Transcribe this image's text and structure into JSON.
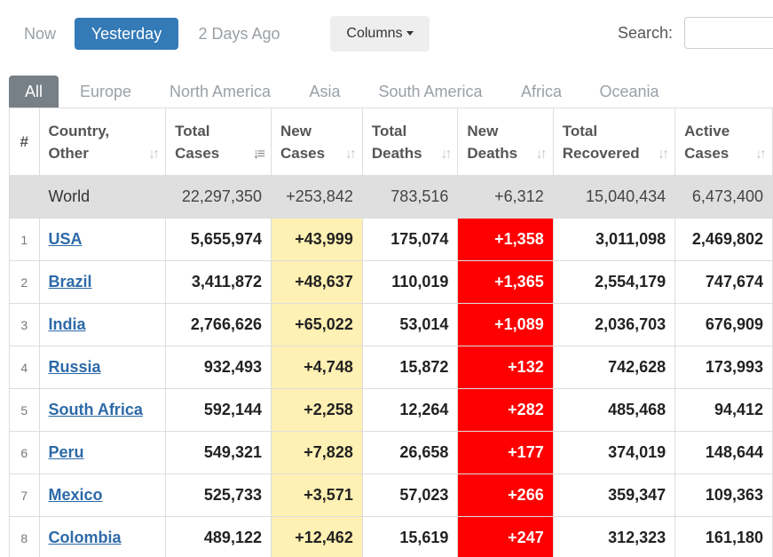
{
  "day_filter": {
    "now": "Now",
    "yesterday": "Yesterday",
    "two_days_ago": "2 Days Ago",
    "selected": "Yesterday"
  },
  "columns_button": "Columns",
  "search": {
    "label": "Search:",
    "value": ""
  },
  "region_tabs": [
    "All",
    "Europe",
    "North America",
    "Asia",
    "South America",
    "Africa",
    "Oceania"
  ],
  "active_tab": "All",
  "headers": {
    "rank": "#",
    "country_line1": "Country,",
    "country_line2": "Other",
    "total_cases_1": "Total",
    "total_cases_2": "Cases",
    "new_cases_1": "New",
    "new_cases_2": "Cases",
    "total_deaths_1": "Total",
    "total_deaths_2": "Deaths",
    "new_deaths_1": "New",
    "new_deaths_2": "Deaths",
    "total_recovered_1": "Total",
    "total_recovered_2": "Recovered",
    "active_cases_1": "Active",
    "active_cases_2": "Cases"
  },
  "world": {
    "country": "World",
    "total_cases": "22,297,350",
    "new_cases": "+253,842",
    "total_deaths": "783,516",
    "new_deaths": "+6,312",
    "total_recovered": "15,040,434",
    "active_cases": "6,473,400"
  },
  "rows": [
    {
      "rank": "1",
      "country": "USA",
      "total_cases": "5,655,974",
      "new_cases": "+43,999",
      "total_deaths": "175,074",
      "new_deaths": "+1,358",
      "total_recovered": "3,011,098",
      "active_cases": "2,469,802"
    },
    {
      "rank": "2",
      "country": "Brazil",
      "total_cases": "3,411,872",
      "new_cases": "+48,637",
      "total_deaths": "110,019",
      "new_deaths": "+1,365",
      "total_recovered": "2,554,179",
      "active_cases": "747,674"
    },
    {
      "rank": "3",
      "country": "India",
      "total_cases": "2,766,626",
      "new_cases": "+65,022",
      "total_deaths": "53,014",
      "new_deaths": "+1,089",
      "total_recovered": "2,036,703",
      "active_cases": "676,909"
    },
    {
      "rank": "4",
      "country": "Russia",
      "total_cases": "932,493",
      "new_cases": "+4,748",
      "total_deaths": "15,872",
      "new_deaths": "+132",
      "total_recovered": "742,628",
      "active_cases": "173,993"
    },
    {
      "rank": "5",
      "country": "South Africa",
      "total_cases": "592,144",
      "new_cases": "+2,258",
      "total_deaths": "12,264",
      "new_deaths": "+282",
      "total_recovered": "485,468",
      "active_cases": "94,412"
    },
    {
      "rank": "6",
      "country": "Peru",
      "total_cases": "549,321",
      "new_cases": "+7,828",
      "total_deaths": "26,658",
      "new_deaths": "+177",
      "total_recovered": "374,019",
      "active_cases": "148,644"
    },
    {
      "rank": "7",
      "country": "Mexico",
      "total_cases": "525,733",
      "new_cases": "+3,571",
      "total_deaths": "57,023",
      "new_deaths": "+266",
      "total_recovered": "359,347",
      "active_cases": "109,363"
    },
    {
      "rank": "8",
      "country": "Colombia",
      "total_cases": "489,122",
      "new_cases": "+12,462",
      "total_deaths": "15,619",
      "new_deaths": "+247",
      "total_recovered": "312,323",
      "active_cases": "161,180"
    }
  ],
  "colors": {
    "accent": "#337ab7",
    "new_cases_highlight": "#fff0b3",
    "new_deaths_highlight": "#ff0000",
    "world_row": "#dfdfdf",
    "link": "#2d6aa8"
  },
  "icons": {
    "sort": "sort-arrows-icon",
    "sort_active": "sort-desc-icon",
    "dropdown": "caret-down-icon"
  }
}
